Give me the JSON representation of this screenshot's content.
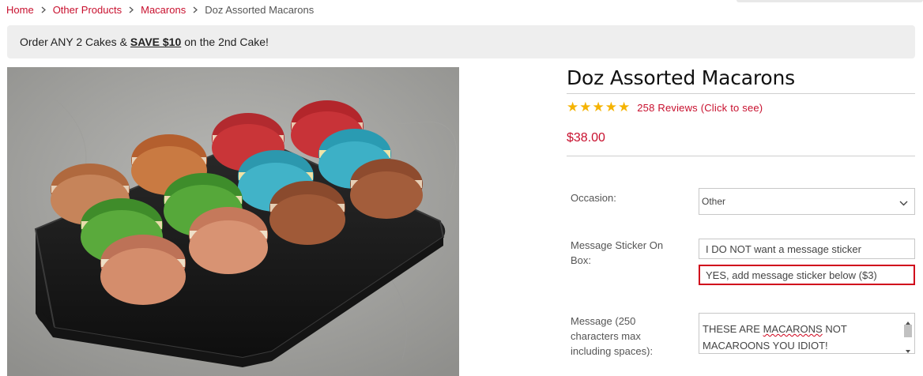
{
  "breadcrumb": {
    "items": [
      "Home",
      "Other Products",
      "Macarons"
    ],
    "current": "Doz Assorted Macarons"
  },
  "promo": {
    "prefix": "Order ANY 2 Cakes &",
    "link": "SAVE $10",
    "suffix": "on the 2nd Cake!"
  },
  "product": {
    "title": "Doz Assorted Macarons",
    "rating": 5,
    "reviews_label": "258 Reviews (Click to see)",
    "price": "$38.00",
    "image_alt": "Box of twelve assorted macarons"
  },
  "form": {
    "occasion_label": "Occasion:",
    "occasion_value": "Other",
    "sticker_label_line1": "Message Sticker On",
    "sticker_label_line2": "Box:",
    "sticker_options": [
      "I DO NOT want a message sticker",
      "YES, add message sticker below ($3)"
    ],
    "sticker_selected_index": 1,
    "message_label_line1": "Message (250",
    "message_label_line2": "characters max",
    "message_label_line3": "including spaces):",
    "message_line1_a": "THESE ARE",
    "message_line1_b": "MACARONS",
    "message_line1_c": "NOT",
    "message_line2": "MACAROONS YOU IDIOT!"
  },
  "colors": {
    "accent": "#c8102e",
    "star": "#f5b301",
    "selected_border": "#d0021b",
    "promo_bg": "#eeeeee"
  }
}
